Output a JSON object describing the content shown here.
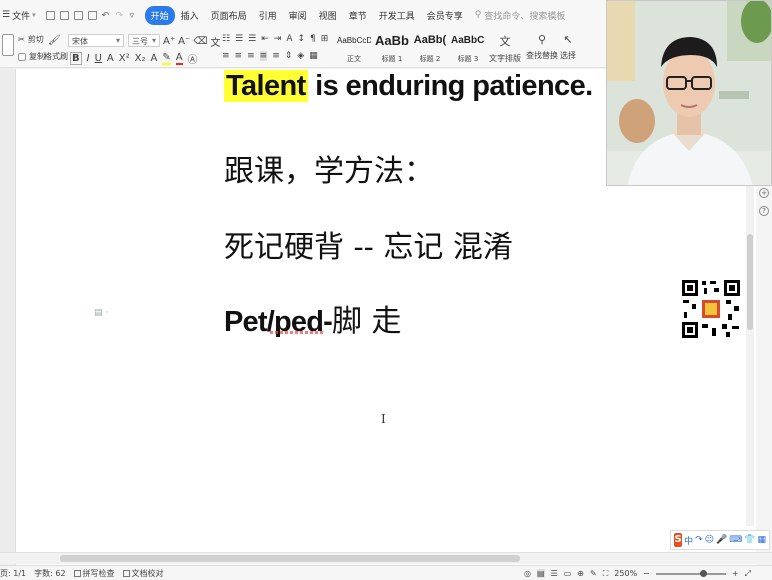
{
  "menubar": {
    "file_label": "文件",
    "tabs": [
      {
        "label": "开始",
        "active": true
      },
      {
        "label": "插入",
        "active": false
      },
      {
        "label": "页面布局",
        "active": false
      },
      {
        "label": "引用",
        "active": false
      },
      {
        "label": "审阅",
        "active": false
      },
      {
        "label": "视图",
        "active": false
      },
      {
        "label": "章节",
        "active": false
      },
      {
        "label": "开发工具",
        "active": false
      },
      {
        "label": "会员专享",
        "active": false
      }
    ],
    "search_placeholder": "查找命令、搜索模板"
  },
  "ribbon": {
    "cut_label": "剪切",
    "copy_label": "复制",
    "format_painter_label": "格式刷",
    "font_name": "宋体",
    "font_size": "三号",
    "styles": [
      {
        "sample": "AaBbCcDd",
        "label": "正文"
      },
      {
        "sample": "AaBb",
        "label": "标题 1"
      },
      {
        "sample": "AaBb(",
        "label": "标题 2"
      },
      {
        "sample": "AaBbC(",
        "label": "标题 3"
      }
    ],
    "text_layout_label": "文字排版",
    "find_replace_label": "查找替换",
    "select_label": "选择"
  },
  "document": {
    "line1_highlight": "Talent",
    "line1_rest": " is enduring patience.",
    "line2": "跟课，学方法：",
    "line3": "死记硬背  --  忘记  混淆",
    "line4_en": "Pet/ped-",
    "line4_cn": "脚  走"
  },
  "ime": {
    "logo": "S",
    "mode": "中"
  },
  "status": {
    "page": "页: 1/1",
    "word_count": "字数: 62",
    "spell_check": "拼写检查",
    "doc_proof": "文档校对",
    "zoom": "250%"
  },
  "colors": {
    "accent": "#2b7bea",
    "highlight": "#ffff33",
    "ime_logo": "#e8501e"
  }
}
